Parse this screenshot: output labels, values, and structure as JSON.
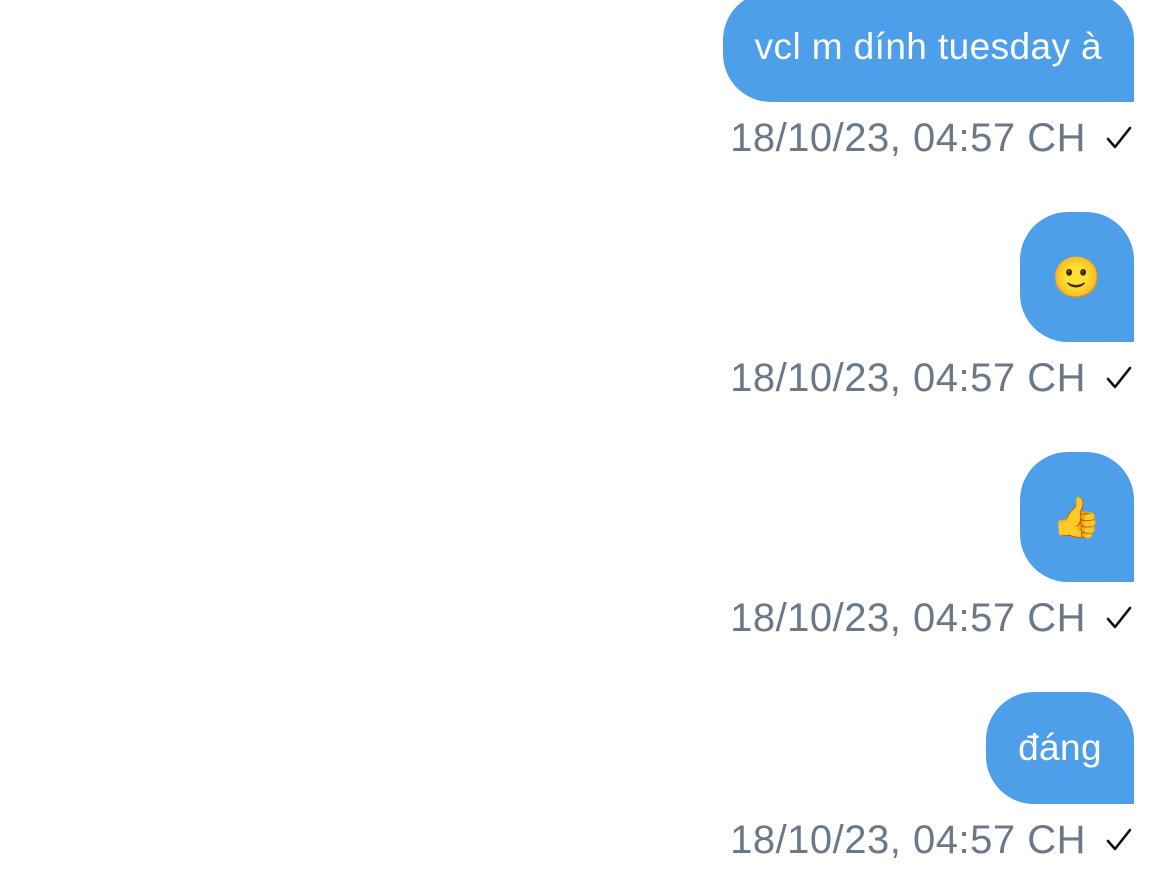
{
  "messages": [
    {
      "text": "vcl m dính tuesday à",
      "timestamp": "18/10/23, 04:57 CH",
      "status": "sent"
    },
    {
      "text": "🙂",
      "timestamp": "18/10/23, 04:57 CH",
      "status": "sent"
    },
    {
      "text": "👍",
      "timestamp": "18/10/23, 04:57 CH",
      "status": "sent"
    },
    {
      "text": "đáng",
      "timestamp": "18/10/23, 04:57 CH",
      "status": "sent"
    }
  ],
  "colors": {
    "outgoing_bubble": "#4d9fea",
    "bubble_text": "#ffffff",
    "timestamp_text": "#6b7888",
    "check": "#111111"
  },
  "icons": {
    "status": "checkmark-icon"
  }
}
